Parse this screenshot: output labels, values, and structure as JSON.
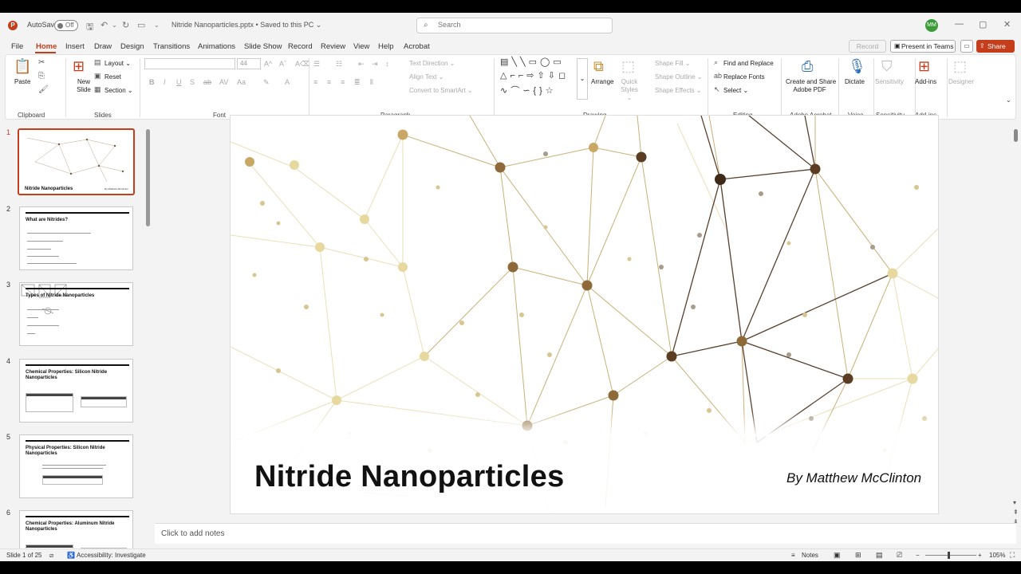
{
  "titlebar": {
    "autosave_label": "AutoSave",
    "autosave_state": "Off",
    "doc_title": "Nitride Nanoparticles.pptx  •  Saved to this PC  ⌄",
    "search_placeholder": "Search",
    "avatar_initials": "MM"
  },
  "tabs": [
    "File",
    "Home",
    "Insert",
    "Draw",
    "Design",
    "Transitions",
    "Animations",
    "Slide Show",
    "Record",
    "Review",
    "View",
    "Help",
    "Acrobat"
  ],
  "active_tab": "Home",
  "right_buttons": {
    "record": "Record",
    "present_teams": "Present in Teams",
    "share": "Share"
  },
  "ribbon": {
    "clipboard": {
      "label": "Clipboard",
      "paste": "Paste"
    },
    "slides": {
      "label": "Slides",
      "new_slide": "New Slide",
      "layout": "Layout ⌄",
      "reset": "Reset",
      "section": "Section ⌄"
    },
    "font": {
      "label": "Font",
      "size": "44"
    },
    "paragraph": {
      "label": "Paragraph",
      "text_direction": "Text Direction ⌄",
      "align_text": "Align Text ⌄",
      "convert_smartart": "Convert to SmartArt ⌄"
    },
    "drawing": {
      "label": "Drawing",
      "arrange": "Arrange",
      "quick_styles": "Quick Styles ⌄",
      "shape_fill": "Shape Fill ⌄",
      "shape_outline": "Shape Outline ⌄",
      "shape_effects": "Shape Effects ⌄"
    },
    "editing": {
      "label": "Editing",
      "find_replace": "Find and Replace",
      "replace_fonts": "Replace Fonts",
      "select": "Select ⌄"
    },
    "acrobat": {
      "label": "Adobe Acrobat",
      "create_share_1": "Create and Share",
      "create_share_2": "Adobe PDF"
    },
    "voice": {
      "label": "Voice",
      "dictate": "Dictate"
    },
    "sensitivity": {
      "label": "Sensitivity",
      "button": "Sensitivity"
    },
    "addins": {
      "label": "Add-ins",
      "button": "Add-ins"
    },
    "designer": {
      "button": "Designer"
    }
  },
  "thumbnails": [
    {
      "num": "1",
      "title": "Nitride Nanoparticles",
      "subtitle": "By Matthew McClinton"
    },
    {
      "num": "2",
      "title": "What are Nitrides?"
    },
    {
      "num": "3",
      "title": "Types of Nitride Nanoparticles"
    },
    {
      "num": "4",
      "title": "Chemical Properties: Silicon Nitride Nanoparticles"
    },
    {
      "num": "5",
      "title": "Physical Properties: Silicon Nitride Nanoparticles"
    },
    {
      "num": "6",
      "title": "Chemical Properties: Aluminum Nitride Nanoparticles"
    }
  ],
  "slide": {
    "title": "Nitride Nanoparticles",
    "author": "By Matthew McClinton"
  },
  "notes_placeholder": "Click to add notes",
  "status": {
    "slide_count": "Slide 1 of 25",
    "accessibility": "Accessibility: Investigate",
    "notes": "Notes",
    "zoom": "105%"
  },
  "colors": {
    "accent": "#c43e1c",
    "avatar": "#3b9b3a"
  }
}
